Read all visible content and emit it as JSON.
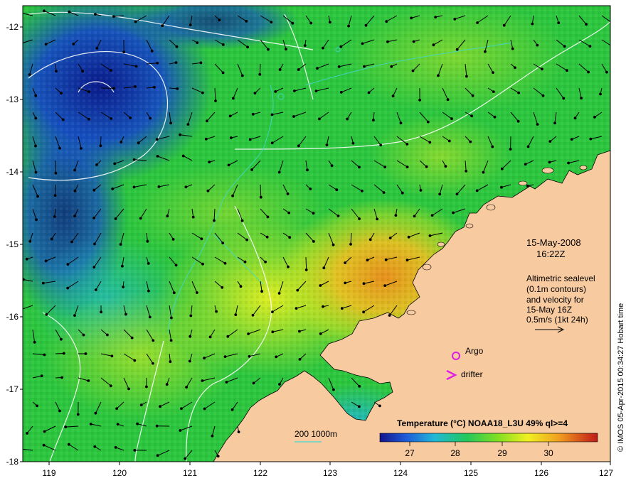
{
  "map": {
    "date": "15-May-2008",
    "time": "16:22Z",
    "altimetry_note_lines": [
      "Altimetric sealevel",
      "(0.1m contours)",
      "and velocity for",
      "15-May 16Z",
      "0.5m/s (1kt 24h)"
    ],
    "legend": {
      "title": "Temperature (°C) NOAA18_L3U 49% ql>=4",
      "ticks": [
        "27",
        "28",
        "29",
        "30"
      ]
    },
    "markers": {
      "argo_label": "Argo",
      "drifter_label": "drifter",
      "argo_color": "#e020e0",
      "drifter_color": "#e020e0"
    },
    "bathymetry_label": "200  1000m",
    "credit": "© IMOS 05-Apr-2015 00:34:27 Hobart time",
    "axes": {
      "lat_ticks": [
        "-12",
        "-13",
        "-14",
        "-15",
        "-16",
        "-17",
        "-18"
      ],
      "lon_ticks": [
        "119",
        "120",
        "121",
        "122",
        "123",
        "124",
        "125",
        "126",
        "127"
      ]
    },
    "colors": {
      "land": "#f8caa0",
      "sst_cold": "#0a1a8a",
      "sst_mid": "#22c43a",
      "sst_warm": "#f0a020",
      "contour": "#ffffff",
      "bathymetry": "#40d8d0"
    }
  }
}
